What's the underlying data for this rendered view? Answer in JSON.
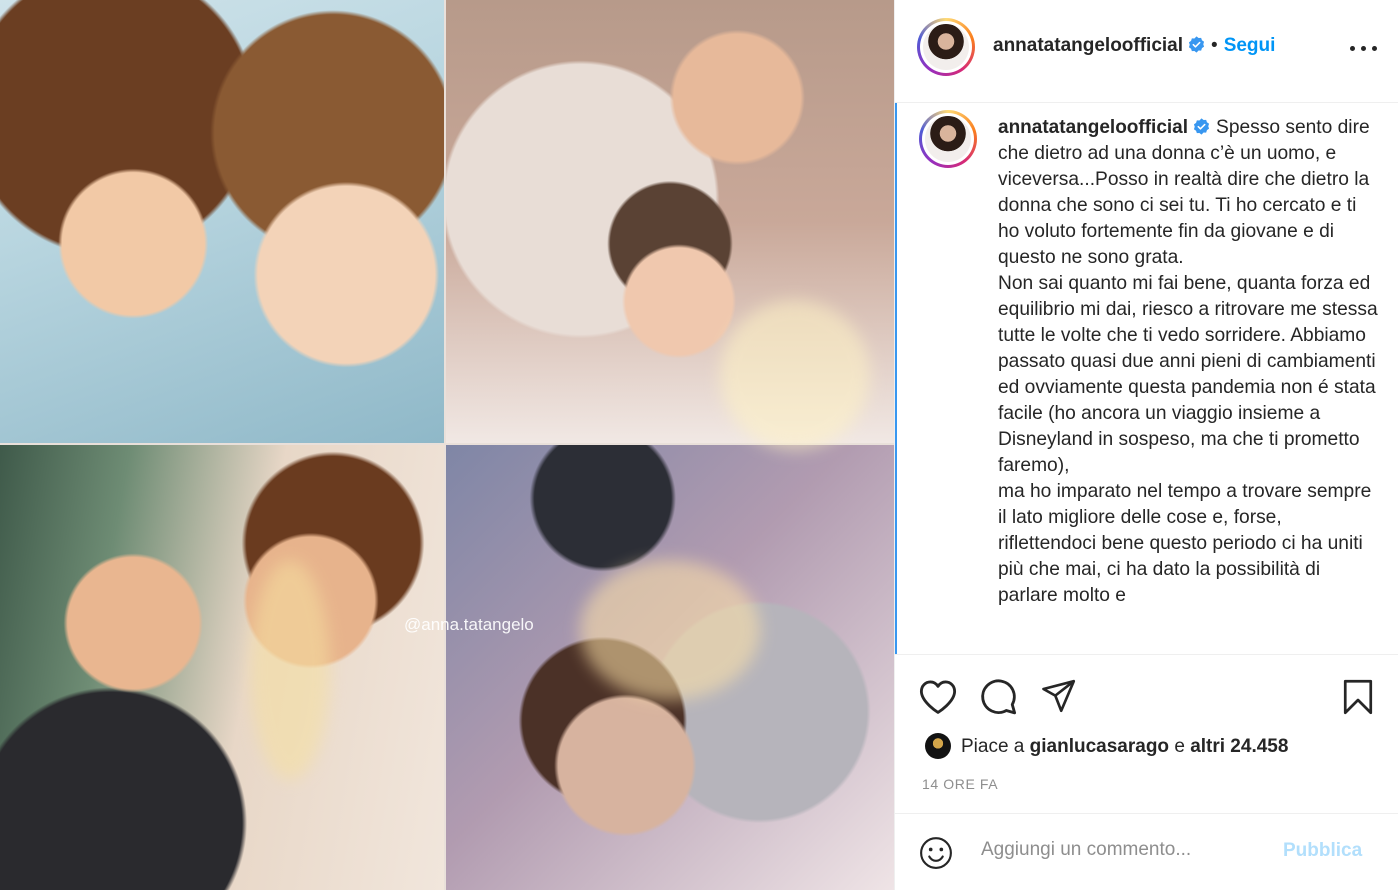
{
  "media": {
    "watermark": "@anna.tatangelo"
  },
  "header": {
    "username": "annatatangeloofficial",
    "separator": "•",
    "follow_label": "Segui"
  },
  "caption": {
    "username": "annatatangeloofficial",
    "lines": [
      "Spesso sento dire che dietro ad una donna c’è un uomo, e viceversa...Posso in realtà dire che dietro la donna che sono ci sei tu. Ti ho cercato e ti ho voluto fortemente fin da giovane e di questo ne sono grata.",
      "Non sai quanto mi fai bene, quanta forza ed equilibrio mi dai, riesco a ritrovare me stessa tutte le volte che ti vedo sorridere. Abbiamo passato quasi due anni pieni di cambiamenti ed ovviamente questa pandemia non é stata facile (ho ancora un viaggio insieme a Disneyland in sospeso, ma che ti prometto faremo),",
      "ma ho imparato nel tempo a trovare sempre il lato migliore delle cose e, forse, riflettendoci bene questo periodo ci ha uniti più che mai, ci ha dato la possibilità di parlare molto e"
    ]
  },
  "likes": {
    "prefix": "Piace a",
    "user": "gianlucasarago",
    "middle": "e",
    "count": "altri 24.458"
  },
  "timestamp": "14 ORE FA",
  "comment_box": {
    "placeholder": "Aggiungi un commento...",
    "publish_label": "Pubblica"
  },
  "colors": {
    "accent": "#0095f6",
    "publish_disabled": "#b2dffc",
    "thread_line": "#3897f0",
    "muted": "#8e8e8e"
  },
  "icons": [
    "more-options-icon",
    "verified-badge-icon",
    "heart-icon",
    "comment-icon",
    "share-icon",
    "bookmark-icon",
    "emoji-icon"
  ]
}
